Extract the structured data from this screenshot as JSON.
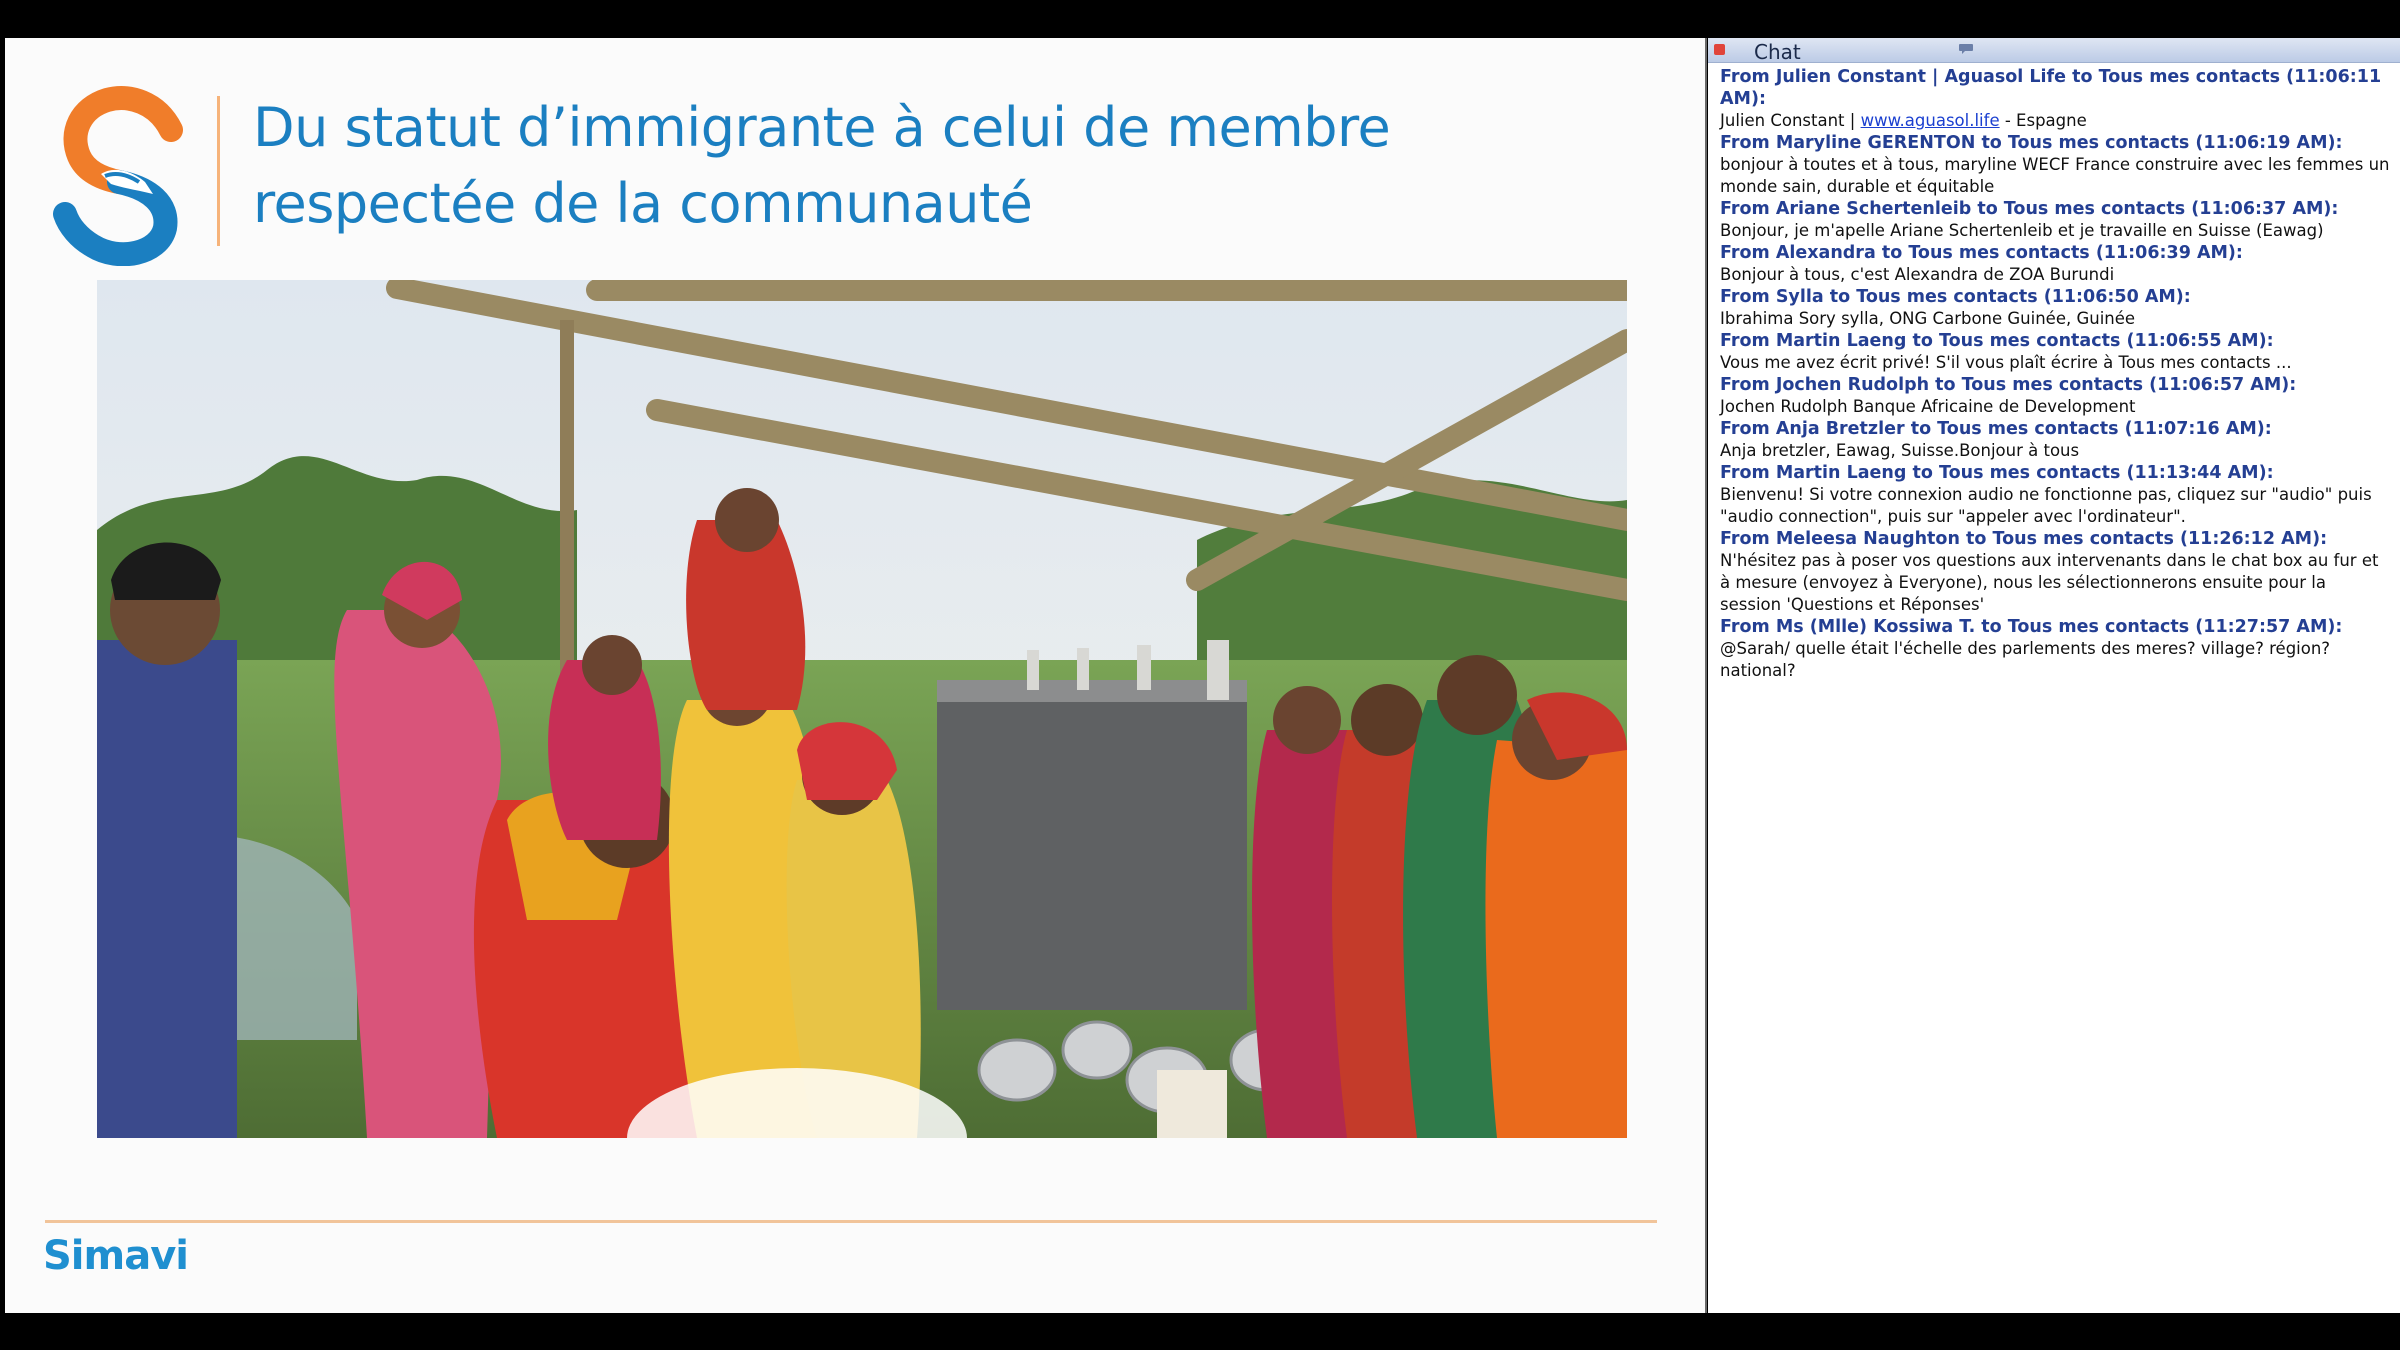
{
  "slide": {
    "title_line1": "Du statut d’immigrante à celui de membre",
    "title_line2": "respectée de la communauté",
    "footer_logo": "Simavi",
    "accent_color": "#1b7fc1",
    "logo_orange": "#f07d2a",
    "logo_blue": "#1b7fc1"
  },
  "chat": {
    "title": "Chat",
    "messages": [
      {
        "head": "From Julien Constant | Aguasol Life to Tous mes contacts (11:06:11 AM):",
        "body_pre": "Julien Constant | ",
        "link": "www.aguasol.life",
        "body_post": " - Espagne"
      },
      {
        "head": "From Maryline GERENTON to Tous mes contacts (11:06:19 AM):",
        "body": "bonjour à toutes et à tous, maryline WECF France construire avec les femmes un monde sain, durable et équitable"
      },
      {
        "head": "From Ariane Schertenleib to Tous mes contacts (11:06:37 AM):",
        "body": "Bonjour, je m'apelle Ariane Schertenleib et je travaille en Suisse (Eawag)"
      },
      {
        "head": "From Alexandra to Tous mes contacts (11:06:39 AM):",
        "body": "Bonjour à tous, c'est Alexandra de ZOA Burundi"
      },
      {
        "head": "From Sylla to Tous mes contacts (11:06:50 AM):",
        "body": "Ibrahima Sory sylla, ONG Carbone Guinée, Guinée"
      },
      {
        "head": "From Martin Laeng to Tous mes contacts (11:06:55 AM):",
        "body": "Vous me avez écrit privé! S'il vous plaît écrire à Tous mes contacts ..."
      },
      {
        "head": "From Jochen Rudolph to Tous mes contacts (11:06:57 AM):",
        "body": "Jochen Rudolph Banque Africaine de Development"
      },
      {
        "head": "From Anja Bretzler to Tous mes contacts (11:07:16 AM):",
        "body": "Anja bretzler, Eawag, Suisse.Bonjour à tous"
      },
      {
        "head": "From Martin Laeng to Tous mes contacts (11:13:44 AM):",
        "body": "Bienvenu! Si votre connexion audio ne fonctionne pas,  cliquez sur \"audio\" puis \"audio connection\", puis sur \"appeler avec l'ordinateur\"."
      },
      {
        "head": "From Meleesa Naughton to Tous mes contacts (11:26:12 AM):",
        "body": "N'hésitez pas à poser vos questions aux intervenants dans le chat box au fur et à mesure (envoyez à Everyone), nous les sélectionnerons ensuite pour la session 'Questions et Réponses'"
      },
      {
        "head": "From Ms (Mlle) Kossiwa T. to Tous mes contacts (11:27:57 AM):",
        "body": "@Sarah/ quelle était l'échelle des parlements des meres? village? région? national?"
      }
    ]
  }
}
